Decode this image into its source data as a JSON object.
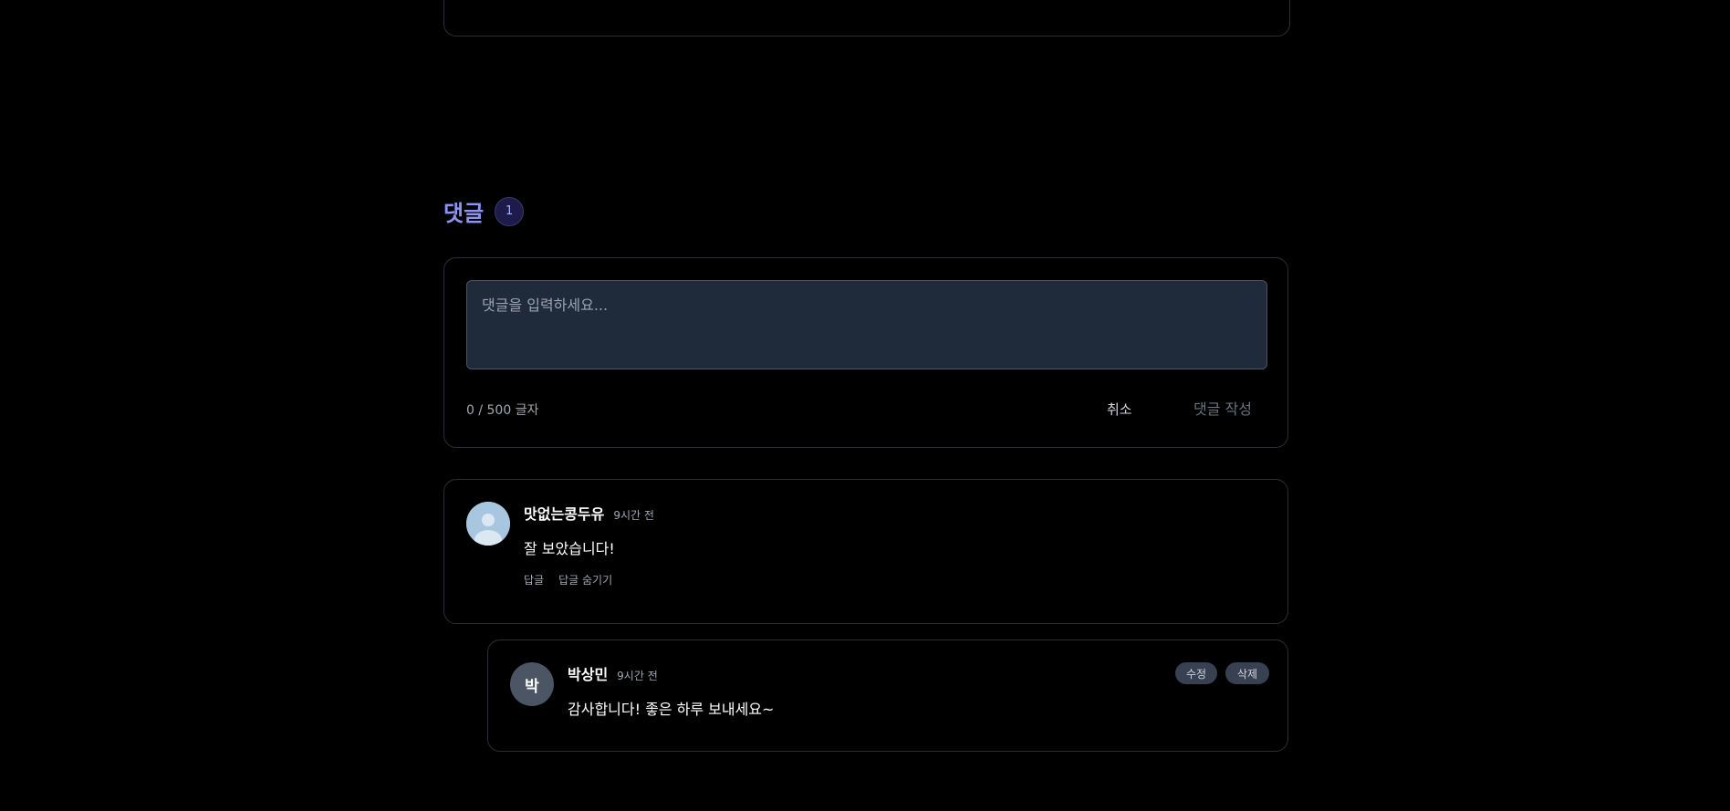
{
  "comments_section": {
    "title": "댓글",
    "count": "1"
  },
  "compose": {
    "placeholder": "댓글을 입력하세요...",
    "char_count": "0 / 500 글자",
    "cancel_label": "취소",
    "submit_label": "댓글 작성"
  },
  "comments": [
    {
      "author": "맛없는콩두유",
      "time": "9시간 전",
      "body": "잘 보았습니다!",
      "avatar_icon": "user-silhouette-icon",
      "actions": {
        "reply_label": "답글",
        "hide_replies_label": "답글 숨기기"
      }
    }
  ],
  "reply": {
    "author": "박상민",
    "avatar_letter": "박",
    "time": "9시간 전",
    "body": "감사합니다! 좋은 하루 보내세요~",
    "edit_label": "수정",
    "delete_label": "삭제"
  },
  "colors": {
    "background": "#000000",
    "accent_title": "#8b93f6",
    "textarea_bg": "#1f2a3a",
    "card_border": "#2a2f37"
  }
}
